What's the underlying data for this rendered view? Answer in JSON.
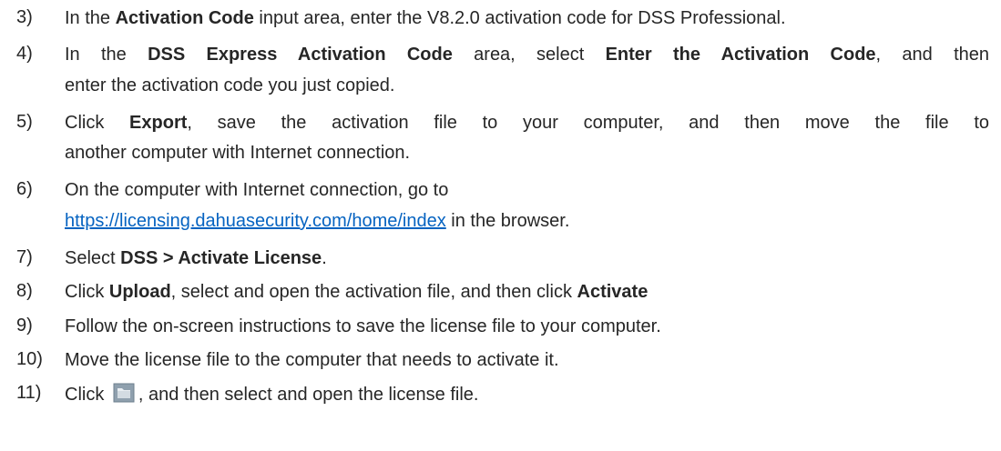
{
  "steps": [
    {
      "num": "3)",
      "lines": [
        [
          {
            "t": "In the ",
            "b": false
          },
          {
            "t": "Activation Code",
            "b": true
          },
          {
            "t": " input area, enter the V8.2.0 activation code for DSS Professional.",
            "b": false
          }
        ]
      ]
    },
    {
      "num": "4)",
      "lines": [
        [
          {
            "t": "In the ",
            "b": false
          },
          {
            "t": "DSS Express Activation Code",
            "b": true
          },
          {
            "t": " area, select ",
            "b": false
          },
          {
            "t": "Enter the Activation Code",
            "b": true
          },
          {
            "t": ", and then",
            "b": false
          }
        ],
        [
          {
            "t": "enter the activation code you just copied.",
            "b": false
          }
        ]
      ]
    },
    {
      "num": "5)",
      "lines": [
        [
          {
            "t": "Click ",
            "b": false
          },
          {
            "t": "Export",
            "b": true
          },
          {
            "t": ", save the activation file to your computer, and then move the file to",
            "b": false
          }
        ],
        [
          {
            "t": "another computer with Internet connection.",
            "b": false
          }
        ]
      ]
    },
    {
      "num": "6)",
      "lines": [
        [
          {
            "t": "On the computer with Internet connection, go to",
            "b": false
          }
        ],
        [
          {
            "t": "https://licensing.dahuasecurity.com/home/index",
            "link": true
          },
          {
            "t": " in the browser.",
            "b": false
          }
        ]
      ]
    },
    {
      "num": "7)",
      "lines": [
        [
          {
            "t": "Select ",
            "b": false
          },
          {
            "t": "DSS > Activate License",
            "b": true
          },
          {
            "t": ".",
            "b": false
          }
        ]
      ]
    },
    {
      "num": "8)",
      "lines": [
        [
          {
            "t": "Click ",
            "b": false
          },
          {
            "t": "Upload",
            "b": true
          },
          {
            "t": ", select and open the activation file, and then click ",
            "b": false
          },
          {
            "t": "Activate",
            "b": true
          }
        ]
      ]
    },
    {
      "num": "9)",
      "lines": [
        [
          {
            "t": "Follow the on-screen instructions to save the license file to your computer.",
            "b": false
          }
        ]
      ]
    },
    {
      "num": "10)",
      "lines": [
        [
          {
            "t": "Move the license file to the computer that needs to activate it.",
            "b": false
          }
        ]
      ]
    },
    {
      "num": "11)",
      "lines": [
        [
          {
            "t": "Click ",
            "b": false
          },
          {
            "icon": "folder-icon"
          },
          {
            "t": ", and then select and open the license file.",
            "b": false
          }
        ]
      ]
    }
  ],
  "colors": {
    "text": "#262626",
    "link": "#0563c1"
  }
}
